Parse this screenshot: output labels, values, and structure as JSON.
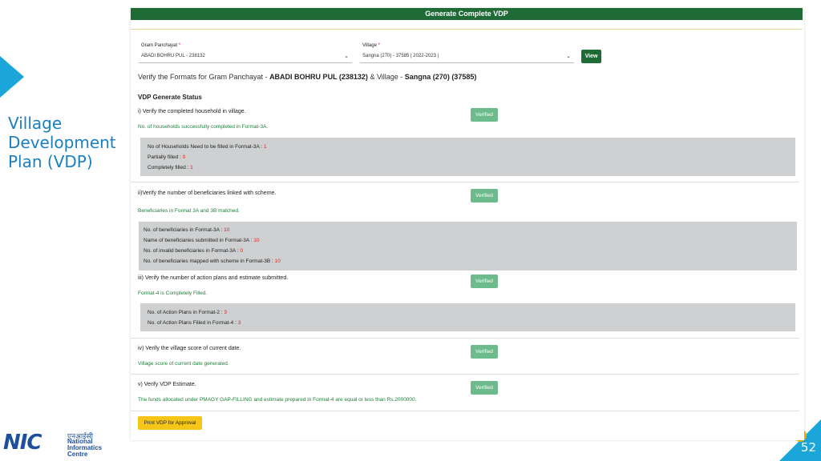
{
  "slide": {
    "title": "Village Development Plan (VDP)",
    "page_number": "52",
    "logo_hindi": "एनआईसी",
    "logo_word": "NIC",
    "logo_lines": [
      "National",
      "Informatics",
      "Centre"
    ]
  },
  "panel": {
    "header": "Generate Complete VDP",
    "gp_label": "Gram Panchayat",
    "gp_value": "ABADI BOHRU PUL - 238132",
    "village_label": "Village",
    "village_value": "Sangna (270) - 37585 | 2022-2023 |",
    "required_mark": "*",
    "view_button": "View",
    "verify_prefix": "Verify the Formats for Gram Panchayat - ",
    "verify_gp": "ABADI BOHRU PUL (238132)",
    "verify_mid": " & Village - ",
    "verify_village": "Sangna (270) (37585)",
    "status_title": "VDP Generate Status",
    "verified_label": "Verified",
    "print_button": "Print VDP for Approval",
    "items": [
      {
        "question": "i) Verify the completed household in village.",
        "result": "No. of households successfully completed in Format-3A.",
        "details": [
          {
            "label": "No of Households Need to be filled in Format-3A : ",
            "value": "1"
          },
          {
            "label": "Partially filled : ",
            "value": "0"
          },
          {
            "label": "Completely filled : ",
            "value": "1"
          }
        ]
      },
      {
        "question": "ii)Verify the number of beneficiaries linked with scheme.",
        "result": "Beneficiaries in Format 3A and 3B matched.",
        "details": [
          {
            "label": "No. of beneficiaries in Format-3A : ",
            "value": "10"
          },
          {
            "label": "Name of beneficiaries submitted in Format-3A : ",
            "value": "10"
          },
          {
            "label": "No. of invalid beneficiaries in Format-3A : ",
            "value": "0"
          },
          {
            "label": "No. of beneficiaries mapped with scheme in Format-3B : ",
            "value": "10"
          }
        ]
      },
      {
        "question": "iii) Verify the number of action plans and estimate submitted.",
        "result": "Format-4 is Completely Filled.",
        "details": [
          {
            "label": "No. of Action Plans in Format-2 : ",
            "value": "3"
          },
          {
            "label": "No. of Action Plans Filled in Format-4 : ",
            "value": "3"
          }
        ]
      },
      {
        "question": "iv) Verify the village score of current date.",
        "result": "Village score of current date generated."
      },
      {
        "question": "v) Verify VDP Estimate.",
        "result": "The funds allocated under PMAGY GAP-FILLING and estimate prepared in Format-4 are equal or less than Rs.2000000."
      }
    ]
  }
}
